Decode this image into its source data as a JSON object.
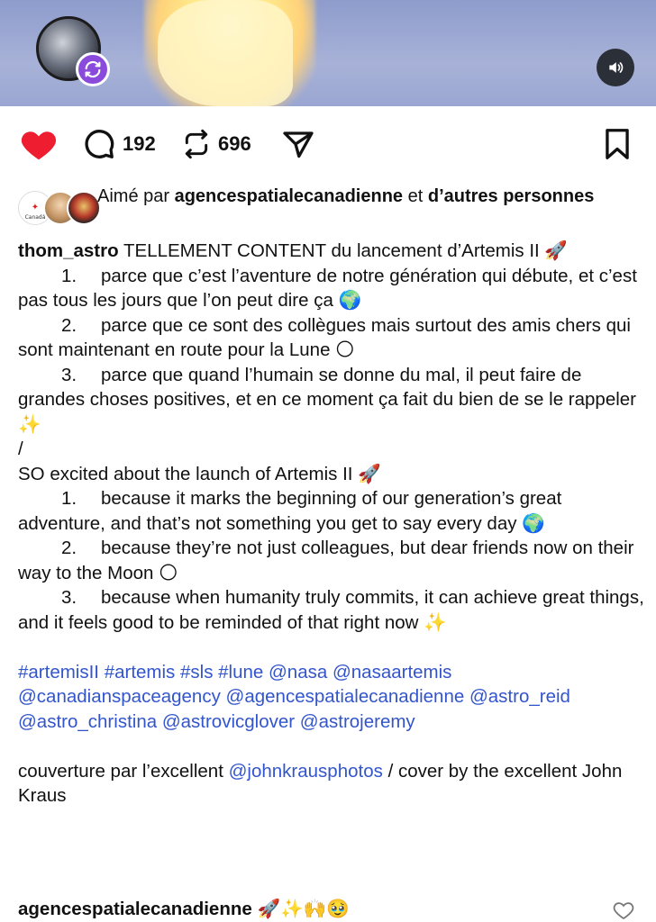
{
  "post": {
    "actions": {
      "comment_count": "192",
      "repost_count": "696"
    },
    "liked_by": {
      "prefix": "Aimé par",
      "account": "agencespatialecanadienne",
      "connector": "et",
      "others": "d’autres personnes"
    },
    "caption": {
      "username": "thom_astro",
      "intro": "TELLEMENT CONTENT du lancement d’Artemis II 🚀",
      "fr_items": [
        {
          "num": "1.",
          "text": "parce que c’est l’aventure de notre génération qui débute, et c’est pas tous les jours que l’on peut dire ça 🌍"
        },
        {
          "num": "2.",
          "text": "parce que ce sont des collègues mais surtout des amis chers qui sont maintenant en route pour la Lune 🌕"
        },
        {
          "num": "3.",
          "text": "parce que quand l’humain se donne du mal, il peut faire de grandes choses positives, et en ce moment ça fait du bien de se le rappeler ✨"
        }
      ],
      "separator": "/",
      "en_intro": "SO excited about the launch of Artemis II 🚀",
      "en_items": [
        {
          "num": "1.",
          "text": "because it marks the beginning of our generation’s great adventure, and that’s not something you get to say every day 🌍"
        },
        {
          "num": "2.",
          "text": "because they’re not just colleagues, but dear friends now on their way to the Moon 🌕"
        },
        {
          "num": "3.",
          "text": "because when humanity truly commits, it can achieve great things, and it feels good to be reminded of that right now ✨"
        }
      ],
      "hashtags": "#artemisII #artemis #sls #lune @nasa @nasaartemis @canadianspaceagency @agencespatialecanadienne @astro_reid @astro_christina @astrovicglover @astrojeremy",
      "cover_prefix": "couverture par l’excellent",
      "cover_link": "@johnkrausphotos",
      "cover_suffix": "/ cover by the excellent John Kraus"
    },
    "next_comment": {
      "username": "agencespatialecanadienne",
      "text": "🚀✨🙌🥹"
    }
  },
  "colors": {
    "like_red": "#ee1d2f",
    "link_blue": "#3355cc",
    "repost_purple": "#8a4bdc"
  },
  "icons": [
    "heart-icon",
    "comment-icon",
    "repost-icon",
    "share-icon",
    "bookmark-icon",
    "sound-icon",
    "repost-badge-icon"
  ]
}
